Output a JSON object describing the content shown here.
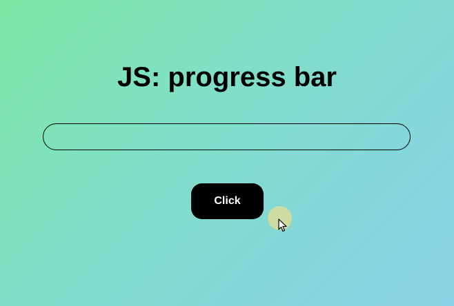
{
  "page": {
    "title": "JS: progress bar"
  },
  "progress": {
    "value": 0
  },
  "button": {
    "label": "Click"
  },
  "cursor": {
    "icon": "arrow-pointer-icon",
    "halo_color": "#dcdc96"
  }
}
